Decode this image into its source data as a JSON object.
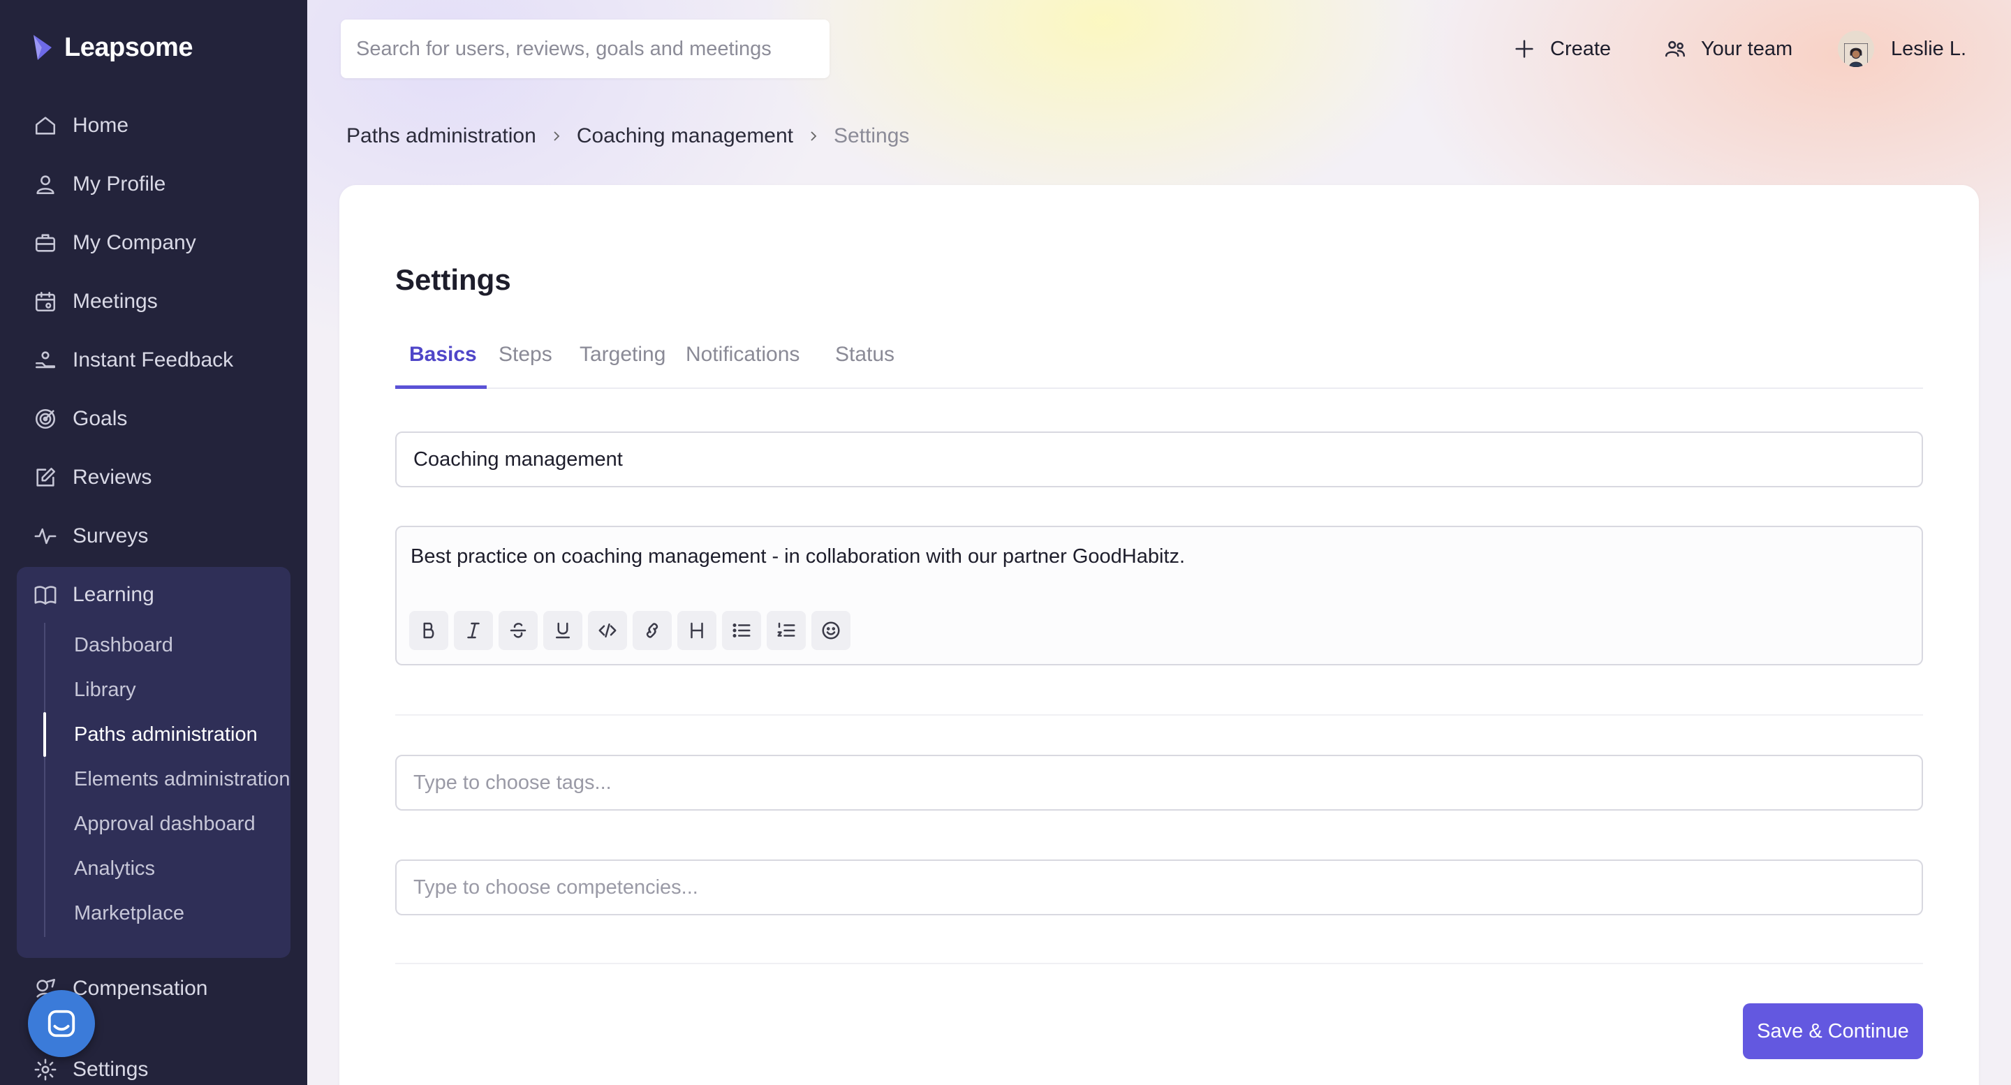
{
  "app": {
    "name": "Leapsome"
  },
  "colors": {
    "sidebar_bg": "#23233b",
    "accent": "#5b52d6",
    "button": "#6358e0",
    "chat": "#3b7bd9"
  },
  "search": {
    "placeholder": "Search for users, reviews, goals and meetings",
    "icon": "none"
  },
  "topbar": {
    "create_label": "Create",
    "team_label": "Your team",
    "user_name": "Leslie L."
  },
  "sidebar": {
    "items": [
      {
        "label": "Home",
        "icon": "home-icon"
      },
      {
        "label": "My Profile",
        "icon": "user-icon"
      },
      {
        "label": "My Company",
        "icon": "briefcase-icon"
      },
      {
        "label": "Meetings",
        "icon": "calendar-icon"
      },
      {
        "label": "Instant Feedback",
        "icon": "feedback-icon"
      },
      {
        "label": "Goals",
        "icon": "target-icon"
      },
      {
        "label": "Reviews",
        "icon": "edit-icon"
      },
      {
        "label": "Surveys",
        "icon": "pulse-icon"
      },
      {
        "label": "Learning",
        "icon": "book-icon"
      }
    ],
    "learning_sub": [
      {
        "label": "Dashboard"
      },
      {
        "label": "Library"
      },
      {
        "label": "Paths administration"
      },
      {
        "label": "Elements administration"
      },
      {
        "label": "Approval dashboard"
      },
      {
        "label": "Analytics"
      },
      {
        "label": "Marketplace"
      }
    ],
    "bottom_items": [
      {
        "label": "Compensation",
        "icon": "compensation-icon"
      },
      {
        "label": "Settings",
        "icon": "gear-icon"
      }
    ]
  },
  "breadcrumb": {
    "items": [
      "Paths administration",
      "Coaching management",
      "Settings"
    ]
  },
  "settings": {
    "title": "Settings",
    "tabs": [
      "Basics",
      "Steps",
      "Targeting",
      "Notifications",
      "Status"
    ],
    "active_tab": "Basics",
    "name_value": "Coaching management",
    "description": "Best practice on coaching management - in collaboration with our partner GoodHabitz.",
    "tags_placeholder": "Type to choose tags...",
    "competencies_placeholder": "Type to choose competencies...",
    "save_label": "Save & Continue"
  }
}
